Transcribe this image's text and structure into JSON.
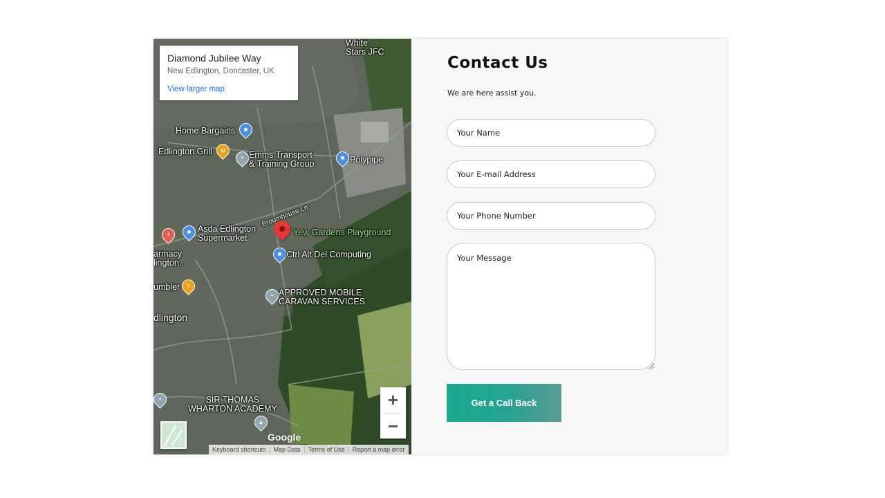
{
  "map": {
    "info": {
      "title": "Diamond Jubilee Way",
      "address": "New Edlington, Doncaster, UK",
      "link": "View larger map"
    },
    "labels": {
      "white_stars": "White\nStars JFC",
      "home_bargains": "Home Bargains",
      "edlington_grill": "Edlington Grill",
      "emms": "Emms Transport\n& Training Group",
      "polypipe": "Polypipe",
      "broomhouse": "Broomhouse Ln",
      "asda": "Asda Edlington\nSupermarket",
      "yew_gardens": "Yew Gardens Playground",
      "pharmacy": "armacy\nlington...",
      "ctrl_alt_del": "Ctrl Alt Del Computing",
      "umbler": "umbler",
      "approved": "APPROVED MOBILE\nCARAVAN SERVICES",
      "edlington": "dlington",
      "sir_thomas": "SIR THOMAS\nWHARTON ACADEMY"
    },
    "zoom_in": "+",
    "zoom_out": "−",
    "google": "Google",
    "attribution": [
      "Keyboard shortcuts",
      "Map Data",
      "Terms of Use",
      "Report a map error"
    ],
    "colors": {
      "shop_pin": "#4a8fe0",
      "food_pin": "#e8a21b",
      "marker": "#e53935",
      "place_pin": "#8fa6b0"
    }
  },
  "form": {
    "title": "Contact Us",
    "subtitle": "We are here assist you.",
    "name_placeholder": "Your Name",
    "email_placeholder": "Your E-mail Address",
    "phone_placeholder": "Your Phone Number",
    "message_placeholder": "Your Message",
    "submit_label": "Get a Call Back",
    "colors": {
      "button_start": "#1aa98f",
      "button_end": "#5b9c93"
    }
  }
}
